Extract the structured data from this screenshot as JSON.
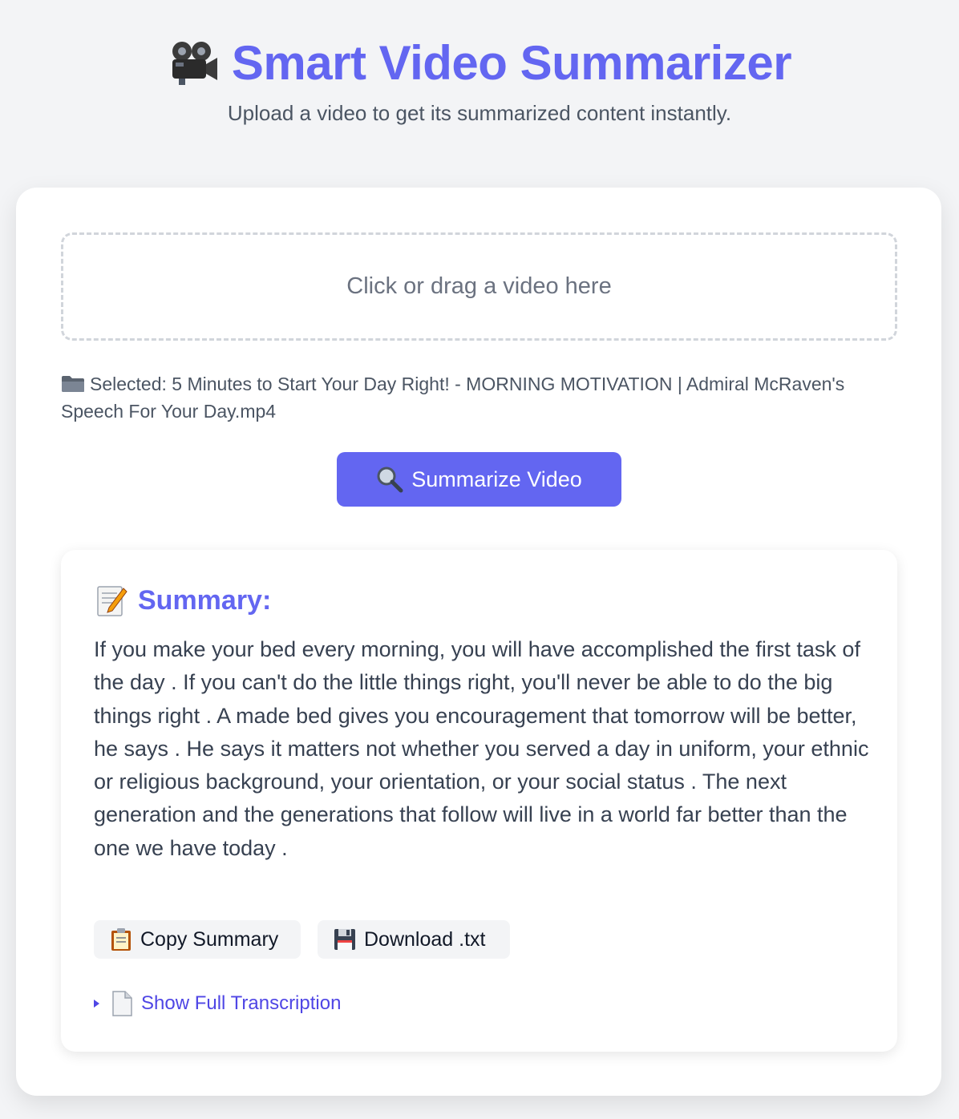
{
  "header": {
    "title": "Smart Video Summarizer",
    "title_icon": "movie-camera-icon",
    "subtitle": "Upload a video to get its summarized content instantly."
  },
  "upload": {
    "dropzone_label": "Click or drag a video here",
    "selected_icon": "folder-icon",
    "selected_text": "Selected: 5 Minutes to Start Your Day Right! - MORNING MOTIVATION | Admiral McRaven's Speech For Your Day.mp4"
  },
  "summarize_button": {
    "icon": "magnifier-icon",
    "label": "Summarize Video"
  },
  "summary": {
    "icon": "memo-icon",
    "heading": "Summary:",
    "text": "If you make your bed every morning, you will have accomplished the first task of the day . If you can't do the little things right, you'll never be able to do the big things right . A made bed gives you encouragement that tomorrow will be better, he says . He says it matters not whether you served a day in uniform, your ethnic or religious background, your orientation, or your social status . The next generation and the generations that follow will live in a world far better than the one we have today .",
    "copy_button": {
      "icon": "clipboard-icon",
      "label": "Copy Summary"
    },
    "download_button": {
      "icon": "floppy-disk-icon",
      "label": "Download .txt"
    },
    "transcription_toggle": {
      "icon": "page-icon",
      "label": "Show Full Transcription"
    }
  },
  "colors": {
    "accent": "#6366f1",
    "link": "#4f46e5",
    "background": "#f3f4f6",
    "card": "#ffffff",
    "text": "#374151"
  }
}
